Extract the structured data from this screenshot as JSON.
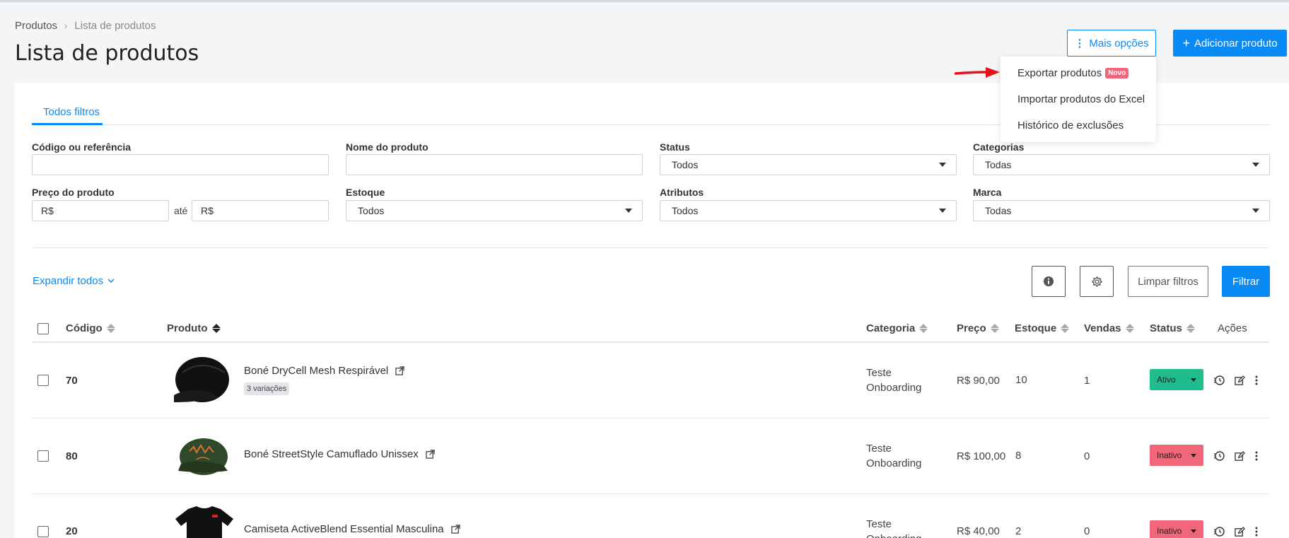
{
  "breadcrumb": {
    "root": "Produtos",
    "current": "Lista de produtos"
  },
  "page_title": "Lista de produtos",
  "header_buttons": {
    "more_options": "Mais opções",
    "add_product": "Adicionar produto"
  },
  "dropdown": {
    "items": [
      {
        "label": "Exportar produtos",
        "badge": "Novo"
      },
      {
        "label": "Importar produtos do Excel"
      },
      {
        "label": "Histórico de exclusões"
      }
    ]
  },
  "tabs": {
    "all_filters": "Todos filtros"
  },
  "filters": {
    "code_label": "Código ou referência",
    "name_label": "Nome do produto",
    "status_label": "Status",
    "status_value": "Todos",
    "categories_label": "Categorias",
    "categories_value": "Todas",
    "price_label": "Preço do produto",
    "price_from": "R$",
    "price_sep": "até",
    "price_to": "R$",
    "stock_label": "Estoque",
    "stock_value": "Todos",
    "attributes_label": "Atributos",
    "attributes_value": "Todos",
    "brand_label": "Marca",
    "brand_value": "Todas"
  },
  "toolbar": {
    "expand_all": "Expandir todos",
    "clear_filters": "Limpar filtros",
    "filter": "Filtrar"
  },
  "table": {
    "headers": {
      "code": "Código",
      "product": "Produto",
      "category": "Categoria",
      "price": "Preço",
      "stock": "Estoque",
      "sales": "Vendas",
      "status": "Status",
      "actions": "Ações"
    },
    "rows": [
      {
        "code": "70",
        "name": "Boné DryCell Mesh Respirável",
        "variations": "3 variações",
        "category_line1": "Teste",
        "category_line2": "Onboarding",
        "price": "R$ 90,00",
        "stock": "10",
        "sales": "1",
        "status": "Ativo"
      },
      {
        "code": "80",
        "name": "Boné StreetStyle Camuflado Unissex",
        "category_line1": "Teste",
        "category_line2": "Onboarding",
        "price": "R$ 100,00",
        "stock": "8",
        "sales": "0",
        "status": "Inativo"
      },
      {
        "code": "20",
        "name": "Camiseta ActiveBlend Essential Masculina",
        "category_line1": "Teste",
        "category_line2": "Onboarding",
        "price": "R$ 40,00",
        "stock": "2",
        "sales": "0",
        "status": "Inativo"
      }
    ]
  },
  "colors": {
    "primary": "#0a8af5",
    "active": "#1fbd8e",
    "inactive": "#f0677a",
    "arrow": "#e8101b"
  }
}
